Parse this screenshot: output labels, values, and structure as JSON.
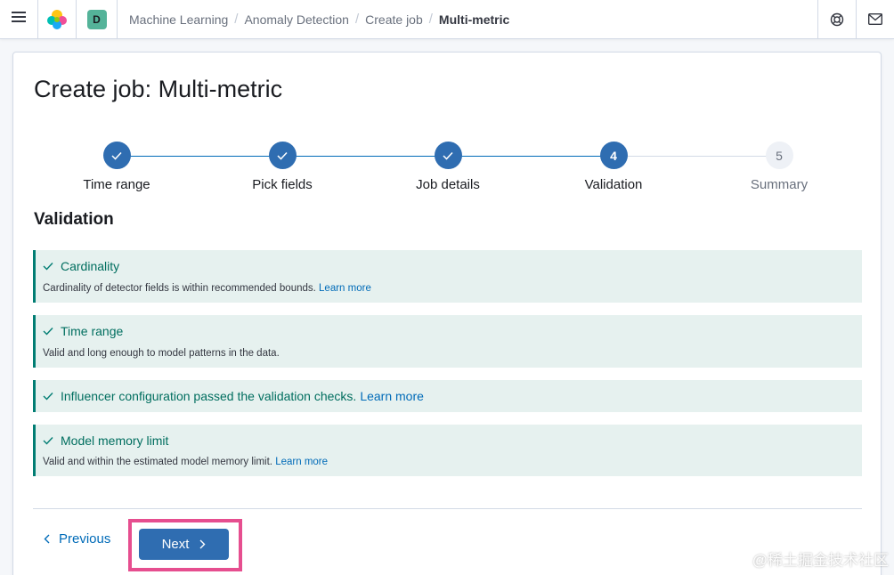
{
  "header": {
    "space_initial": "D",
    "breadcrumbs": [
      "Machine Learning",
      "Anomaly Detection",
      "Create job",
      "Multi-metric"
    ]
  },
  "page": {
    "title": "Create job: Multi-metric",
    "section_title": "Validation"
  },
  "steps": [
    {
      "label": "Time range",
      "status": "complete"
    },
    {
      "label": "Pick fields",
      "status": "complete"
    },
    {
      "label": "Job details",
      "status": "complete"
    },
    {
      "label": "Validation",
      "status": "current",
      "number": "4"
    },
    {
      "label": "Summary",
      "status": "incomplete",
      "number": "5"
    }
  ],
  "callouts": [
    {
      "title": "Cardinality",
      "body": "Cardinality of detector fields is within recommended bounds.",
      "link": "Learn more"
    },
    {
      "title": "Time range",
      "body": "Valid and long enough to model patterns in the data."
    },
    {
      "title": "Influencer configuration passed the validation checks.",
      "link": "Learn more"
    },
    {
      "title": "Model memory limit",
      "body": "Valid and within the estimated model memory limit.",
      "link": "Learn more"
    }
  ],
  "actions": {
    "previous_label": "Previous",
    "next_label": "Next"
  },
  "watermark": "@稀土掘金技术社区",
  "colors": {
    "primary": "#2f6db1",
    "link": "#006bb8",
    "success_text": "#006e5f",
    "success_bg": "#e6f1ef",
    "highlight": "#e64e8f"
  }
}
